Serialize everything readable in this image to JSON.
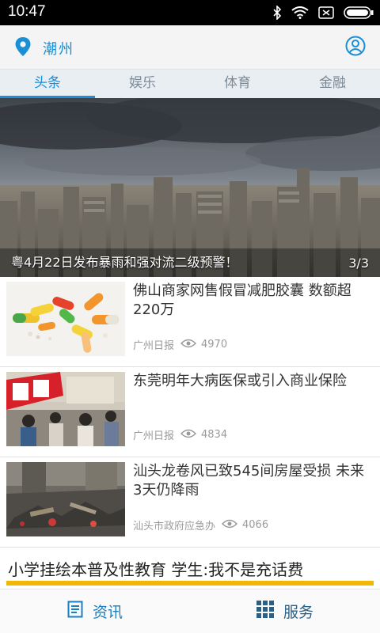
{
  "status_bar": {
    "time": "10:47",
    "icons": [
      "bluetooth-icon",
      "wifi-icon",
      "sim-icon",
      "battery-icon"
    ]
  },
  "header": {
    "city": "潮州",
    "icons": [
      "location-pin-icon",
      "user-profile-icon"
    ],
    "accent_color": "#1b8fd6"
  },
  "tabs": [
    {
      "label": "头条",
      "active": true
    },
    {
      "label": "娱乐",
      "active": false
    },
    {
      "label": "体育",
      "active": false
    },
    {
      "label": "金融",
      "active": false
    }
  ],
  "banner": {
    "caption": "粤4月22日发布暴雨和强对流二级预警！",
    "pager": "3/3"
  },
  "news": [
    {
      "title": "佛山商家网售假冒减肥胶囊 数额超220万",
      "source": "广州日报",
      "views": "4970"
    },
    {
      "title": "东莞明年大病医保或引入商业保险",
      "source": "广州日报",
      "views": "4834"
    },
    {
      "title": "汕头龙卷风已致545间房屋受损 未来3天仍降雨",
      "source": "汕头市政府应急办",
      "views": "4066"
    }
  ],
  "headline": {
    "text": "小学挂绘本普及性教育 学生:我不是充话费"
  },
  "bottom_nav": {
    "news_label": "资讯",
    "services_label": "服务"
  }
}
